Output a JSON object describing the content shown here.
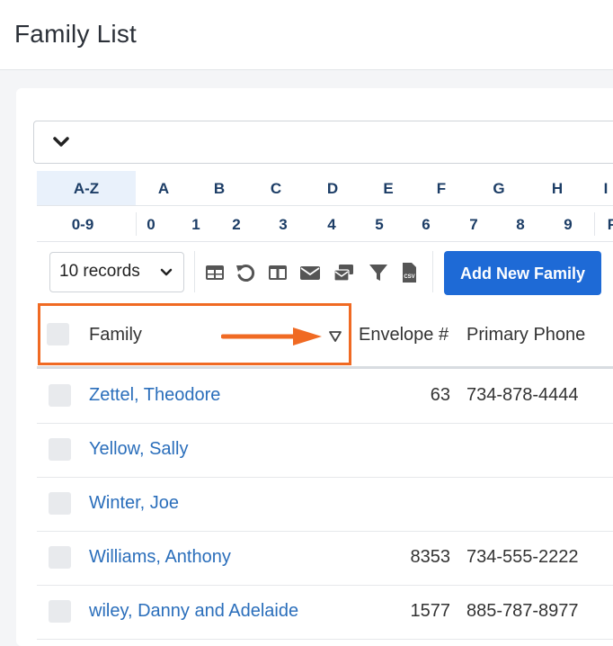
{
  "page": {
    "title": "Family List"
  },
  "filter": {
    "chevron_icon": "chevron-down-icon"
  },
  "alpha_row1": [
    "A-Z",
    "A",
    "B",
    "C",
    "D",
    "E",
    "F",
    "G",
    "H",
    "I"
  ],
  "alpha_row2": [
    "0-9",
    "0",
    "1",
    "2",
    "3",
    "4",
    "5",
    "6",
    "7",
    "8",
    "9",
    "F"
  ],
  "toolbar": {
    "records_value": "10 records",
    "icons": [
      "table-icon",
      "reset-icon",
      "columns-icon",
      "email-icon",
      "mail-merge-icon",
      "filter-icon",
      "csv-icon"
    ],
    "add_label": "Add New Family"
  },
  "table": {
    "headers": {
      "family": "Family",
      "envelope": "Envelope #",
      "phone": "Primary Phone"
    },
    "sort_icon": "sort-triangle-icon",
    "annotation_arrow_color": "#f06a23",
    "rows": [
      {
        "family": "Zettel, Theodore",
        "envelope": "63",
        "phone": "734-878-4444"
      },
      {
        "family": "Yellow, Sally",
        "envelope": "",
        "phone": ""
      },
      {
        "family": "Winter, Joe",
        "envelope": "",
        "phone": ""
      },
      {
        "family": "Williams, Anthony",
        "envelope": "8353",
        "phone": "734-555-2222"
      },
      {
        "family": "wiley, Danny and Adelaide",
        "envelope": "1577",
        "phone": "885-787-8977"
      }
    ]
  },
  "colors": {
    "accent": "#1e6ad6",
    "link": "#2a6ebb",
    "highlight": "#f06a23",
    "alpha_text": "#1c3d66"
  }
}
